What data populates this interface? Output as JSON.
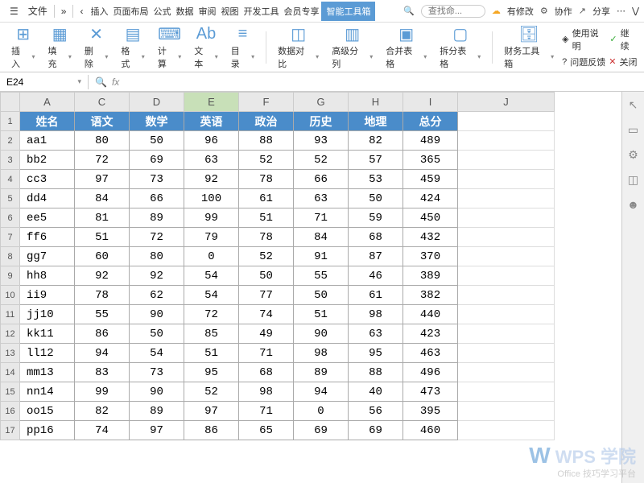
{
  "menubar": {
    "file": "文件",
    "tabs": [
      "插入",
      "页面布局",
      "公式",
      "数据",
      "审阅",
      "视图",
      "开发工具",
      "会员专享",
      "智能工具箱"
    ],
    "active_tab_index": 8,
    "search_placeholder": "查找命...",
    "cloud": "有修改",
    "collab": "协作",
    "share": "分享"
  },
  "ribbon": {
    "items": [
      {
        "label": "插入",
        "icon": "⊞"
      },
      {
        "label": "填充",
        "icon": "▦"
      },
      {
        "label": "删除",
        "icon": "✕"
      },
      {
        "label": "格式",
        "icon": "▤"
      },
      {
        "label": "计算",
        "icon": "⌨"
      },
      {
        "label": "文本",
        "icon": "Ab"
      },
      {
        "label": "目录",
        "icon": "≡"
      },
      {
        "label": "数据对比",
        "icon": "◫"
      },
      {
        "label": "高级分列",
        "icon": "▥"
      },
      {
        "label": "合并表格",
        "icon": "▣"
      },
      {
        "label": "拆分表格",
        "icon": "▢"
      },
      {
        "label": "财务工具箱",
        "icon": "🗄"
      }
    ],
    "right": {
      "help": "使用说明",
      "cont": "继续",
      "feedback": "问题反馈",
      "close": "关闭"
    }
  },
  "formula": {
    "cell_ref": "E24",
    "fx": "fx",
    "value": ""
  },
  "sheet": {
    "col_letters": [
      "A",
      "C",
      "D",
      "E",
      "F",
      "G",
      "H",
      "I",
      "J"
    ],
    "selected_col_index": 3,
    "headers": [
      "姓名",
      "语文",
      "数学",
      "英语",
      "政治",
      "历史",
      "地理",
      "总分"
    ],
    "rows": [
      [
        "aa1",
        "80",
        "50",
        "96",
        "88",
        "93",
        "82",
        "489"
      ],
      [
        "bb2",
        "72",
        "69",
        "63",
        "52",
        "52",
        "57",
        "365"
      ],
      [
        "cc3",
        "97",
        "73",
        "92",
        "78",
        "66",
        "53",
        "459"
      ],
      [
        "dd4",
        "84",
        "66",
        "100",
        "61",
        "63",
        "50",
        "424"
      ],
      [
        "ee5",
        "81",
        "89",
        "99",
        "51",
        "71",
        "59",
        "450"
      ],
      [
        "ff6",
        "51",
        "72",
        "79",
        "78",
        "84",
        "68",
        "432"
      ],
      [
        "gg7",
        "60",
        "80",
        "0",
        "52",
        "91",
        "87",
        "370"
      ],
      [
        "hh8",
        "92",
        "92",
        "54",
        "50",
        "55",
        "46",
        "389"
      ],
      [
        "ii9",
        "78",
        "62",
        "54",
        "77",
        "50",
        "61",
        "382"
      ],
      [
        "jj10",
        "55",
        "90",
        "72",
        "74",
        "51",
        "98",
        "440"
      ],
      [
        "kk11",
        "86",
        "50",
        "85",
        "49",
        "90",
        "63",
        "423"
      ],
      [
        "ll12",
        "94",
        "54",
        "51",
        "71",
        "98",
        "95",
        "463"
      ],
      [
        "mm13",
        "83",
        "73",
        "95",
        "68",
        "89",
        "88",
        "496"
      ],
      [
        "nn14",
        "99",
        "90",
        "52",
        "98",
        "94",
        "40",
        "473"
      ],
      [
        "oo15",
        "82",
        "89",
        "97",
        "71",
        "0",
        "56",
        "395"
      ],
      [
        "pp16",
        "74",
        "97",
        "86",
        "65",
        "69",
        "69",
        "460"
      ]
    ]
  },
  "chart_data": {
    "type": "table",
    "title": "",
    "columns": [
      "姓名",
      "语文",
      "数学",
      "英语",
      "政治",
      "历史",
      "地理",
      "总分"
    ],
    "data": [
      {
        "姓名": "aa1",
        "语文": 80,
        "数学": 50,
        "英语": 96,
        "政治": 88,
        "历史": 93,
        "地理": 82,
        "总分": 489
      },
      {
        "姓名": "bb2",
        "语文": 72,
        "数学": 69,
        "英语": 63,
        "政治": 52,
        "历史": 52,
        "地理": 57,
        "总分": 365
      },
      {
        "姓名": "cc3",
        "语文": 97,
        "数学": 73,
        "英语": 92,
        "政治": 78,
        "历史": 66,
        "地理": 53,
        "总分": 459
      },
      {
        "姓名": "dd4",
        "语文": 84,
        "数学": 66,
        "英语": 100,
        "政治": 61,
        "历史": 63,
        "地理": 50,
        "总分": 424
      },
      {
        "姓名": "ee5",
        "语文": 81,
        "数学": 89,
        "英语": 99,
        "政治": 51,
        "历史": 71,
        "地理": 59,
        "总分": 450
      },
      {
        "姓名": "ff6",
        "语文": 51,
        "数学": 72,
        "英语": 79,
        "政治": 78,
        "历史": 84,
        "地理": 68,
        "总分": 432
      },
      {
        "姓名": "gg7",
        "语文": 60,
        "数学": 80,
        "英语": 0,
        "政治": 52,
        "历史": 91,
        "地理": 87,
        "总分": 370
      },
      {
        "姓名": "hh8",
        "语文": 92,
        "数学": 92,
        "英语": 54,
        "政治": 50,
        "历史": 55,
        "地理": 46,
        "总分": 389
      },
      {
        "姓名": "ii9",
        "语文": 78,
        "数学": 62,
        "英语": 54,
        "政治": 77,
        "历史": 50,
        "地理": 61,
        "总分": 382
      },
      {
        "姓名": "jj10",
        "语文": 55,
        "数学": 90,
        "英语": 72,
        "政治": 74,
        "历史": 51,
        "地理": 98,
        "总分": 440
      },
      {
        "姓名": "kk11",
        "语文": 86,
        "数学": 50,
        "英语": 85,
        "政治": 49,
        "历史": 90,
        "地理": 63,
        "总分": 423
      },
      {
        "姓名": "ll12",
        "语文": 94,
        "数学": 54,
        "英语": 51,
        "政治": 71,
        "历史": 98,
        "地理": 95,
        "总分": 463
      },
      {
        "姓名": "mm13",
        "语文": 83,
        "数学": 73,
        "英语": 95,
        "政治": 68,
        "历史": 89,
        "地理": 88,
        "总分": 496
      },
      {
        "姓名": "nn14",
        "语文": 99,
        "数学": 90,
        "英语": 52,
        "政治": 98,
        "历史": 94,
        "地理": 40,
        "总分": 473
      },
      {
        "姓名": "oo15",
        "语文": 82,
        "数学": 89,
        "英语": 97,
        "政治": 71,
        "历史": 0,
        "地理": 56,
        "总分": 395
      },
      {
        "姓名": "pp16",
        "语文": 74,
        "数学": 97,
        "英语": 86,
        "政治": 65,
        "历史": 69,
        "地理": 69,
        "总分": 460
      }
    ]
  },
  "watermark": {
    "main": "WPS 学院",
    "sub": "Office 技巧学习平台"
  }
}
